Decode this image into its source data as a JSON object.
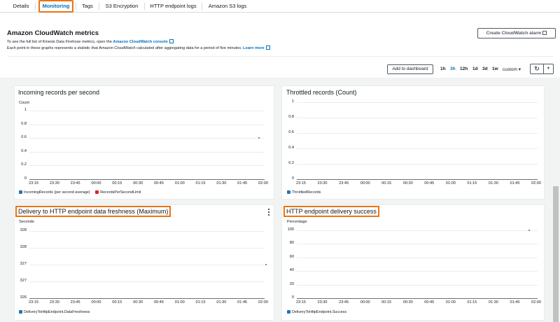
{
  "tabs": [
    "Details",
    "Monitoring",
    "Tags",
    "S3 Encryption",
    "HTTP endpoint logs",
    "Amazon S3 logs"
  ],
  "active_tab": "Monitoring",
  "header": {
    "title": "Amazon CloudWatch metrics",
    "desc1_prefix": "To see the full list of Kinesis Data Firehose metrics, open the ",
    "desc1_link": "Amazon CloudWatch console",
    "desc2_prefix": "Each point in these graphs represents a statistic that Amazon CloudWatch calculated after aggregating data for a period of five minutes. ",
    "desc2_link": "Learn more",
    "create_alarm": "Create CloudWatch alarm"
  },
  "toolbar": {
    "add_dashboard": "Add to dashboard",
    "ranges": [
      "1h",
      "3h",
      "12h",
      "1d",
      "3d",
      "1w"
    ],
    "selected_range": "3h",
    "custom": "custom",
    "custom_caret": "▾",
    "refresh_icon": "↻",
    "dropdown_icon": "▾"
  },
  "x_ticks": [
    "23:15",
    "23:30",
    "23:45",
    "00:00",
    "00:15",
    "00:30",
    "00:45",
    "01:00",
    "01:15",
    "01:30",
    "01:45",
    "02:00"
  ],
  "panels": {
    "incoming": {
      "title": "Incoming records per second",
      "unit": "Count",
      "yticks": [
        "1",
        "0.8",
        "0.6",
        "0.4",
        "0.2",
        "0"
      ],
      "legend": [
        {
          "label": "IncomingRecords (per second average)",
          "color": "#1f77b4"
        },
        {
          "label": "RecordsPerSecondLimit",
          "color": "#d62728"
        }
      ],
      "points": [
        {
          "x": "01:57",
          "y": 0.6
        }
      ]
    },
    "throttled": {
      "title": "Throttled records (Count)",
      "yticks": [
        "1",
        "0.8",
        "0.6",
        "0.4",
        "0.2",
        "0"
      ],
      "legend": [
        {
          "label": "ThrottledRecords",
          "color": "#1f77b4"
        }
      ],
      "points": []
    },
    "freshness": {
      "title": "Delivery to HTTP endpoint data freshness (Maximum)",
      "unit": "Seconds",
      "yticks": [
        "328",
        "328",
        "327",
        "327",
        "326"
      ],
      "legend": [
        {
          "label": "DeliveryToHttpEndpoint.DataFreshness",
          "color": "#1f77b4"
        }
      ],
      "points": [
        {
          "x": "02:02",
          "y": 327
        }
      ],
      "menu_icon": "more-vertical-icon"
    },
    "success": {
      "title": "HTTP endpoint delivery success",
      "unit": "Percentage",
      "yticks": [
        "100",
        "80",
        "60",
        "40",
        "20",
        "0"
      ],
      "legend": [
        {
          "label": "DeliveryToHttpEndpoint.Success",
          "color": "#1f77b4"
        }
      ],
      "points": [
        {
          "x": "01:55",
          "y": 100
        }
      ]
    }
  },
  "icons": {
    "external": "external-link-icon",
    "refresh": "refresh-icon",
    "menu": "more-vertical-icon"
  }
}
